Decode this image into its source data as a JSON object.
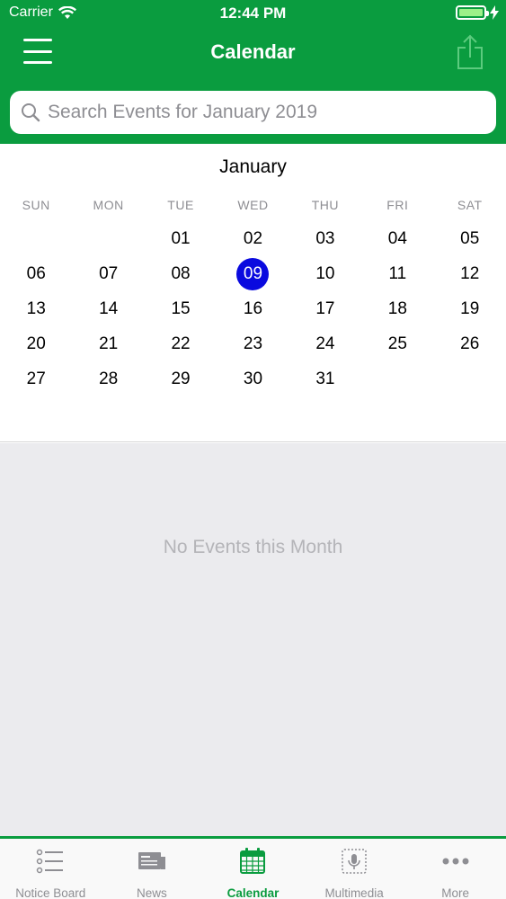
{
  "status_bar": {
    "carrier": "Carrier",
    "time": "12:44 PM"
  },
  "nav": {
    "title": "Calendar"
  },
  "search": {
    "placeholder": "Search Events for January 2019"
  },
  "calendar": {
    "month": "January",
    "weekdays": [
      "SUN",
      "MON",
      "TUE",
      "WED",
      "THU",
      "FRI",
      "SAT"
    ],
    "leading_blanks": 2,
    "days": [
      "01",
      "02",
      "03",
      "04",
      "05",
      "06",
      "07",
      "08",
      "09",
      "10",
      "11",
      "12",
      "13",
      "14",
      "15",
      "16",
      "17",
      "18",
      "19",
      "20",
      "21",
      "22",
      "23",
      "24",
      "25",
      "26",
      "27",
      "28",
      "29",
      "30",
      "31"
    ],
    "selected_day": "09"
  },
  "events": {
    "empty_message": "No Events this Month"
  },
  "tabs": [
    {
      "label": "Notice Board",
      "icon": "list-icon",
      "active": false
    },
    {
      "label": "News",
      "icon": "newspaper-icon",
      "active": false
    },
    {
      "label": "Calendar",
      "icon": "calendar-icon",
      "active": true
    },
    {
      "label": "Multimedia",
      "icon": "microphone-icon",
      "active": false
    },
    {
      "label": "More",
      "icon": "more-dots-icon",
      "active": false
    }
  ],
  "colors": {
    "brand_green": "#0a9c3f",
    "selected_blue": "#0a0adf",
    "battery_green": "#9cf089"
  }
}
